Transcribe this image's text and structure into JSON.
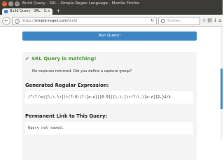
{
  "window": {
    "title": "Build Query - SRL - Simple Regex Language - Mozilla Firefox",
    "close_glyph": "×",
    "min_glyph": "–",
    "max_glyph": "+"
  },
  "tab": {
    "label": "Build Query - SRL - S...",
    "close_glyph": "×",
    "new_tab_glyph": "+"
  },
  "navigation": {
    "back_glyph": "←",
    "info_glyph": "i",
    "url_prefix": "https://",
    "url_host": "simple-regex.com",
    "url_path": "/build",
    "reload_glyph": "↻",
    "search_placeholder": "Suchen",
    "icons": [
      "star-icon",
      "clipboard-icon",
      "download-icon",
      "home-icon"
    ],
    "icon_glyphs": [
      "☆",
      "▤",
      "↓",
      "⌂"
    ]
  },
  "page": {
    "run_button_label": "Run Query!",
    "success_glyph": "✔",
    "success_message": "SRL Query is matching!",
    "captures_message": "No captures returned. Did you define a capture group?",
    "regex_heading": "Generated Regular Expression:",
    "regex_value": "/^(?:\\w|[\\.\\-\\+])+(?:0)(?:[a-z]|[0-9]|[\\.\\-])+(?:\\.)[a-z]{2,}$/i",
    "link_heading": "Permanent Link to This Query:",
    "link_value": "Query not saved."
  },
  "colors": {
    "accent": "#3d86c6",
    "success": "#4a9a36",
    "panel": "#f4f4f4",
    "titlebar": "#3c3b37"
  }
}
